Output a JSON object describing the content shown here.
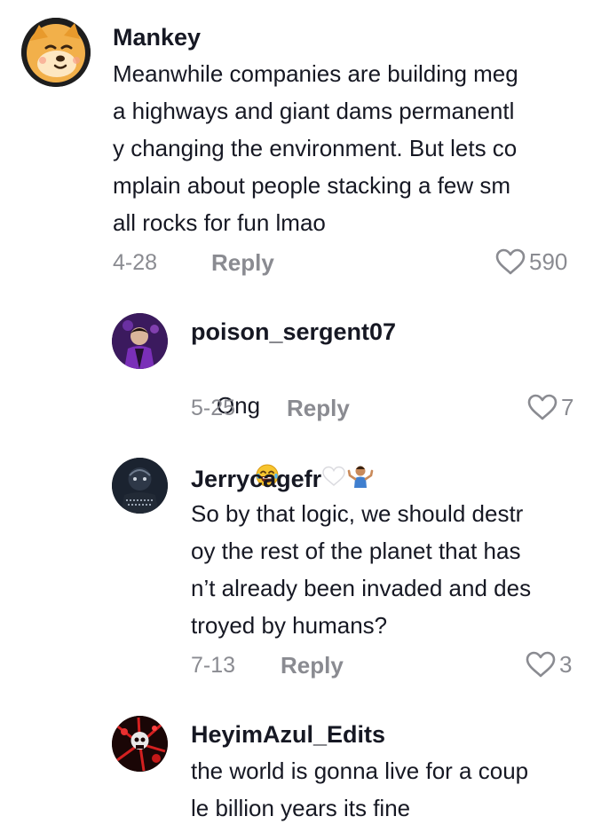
{
  "comments": [
    {
      "username": "Mankey",
      "lines": [
        "Meanwhile companies are building meg",
        "a highways and giant dams permanentl",
        "y changing the environment. But lets co",
        "mplain about people stacking a few sm",
        "all rocks for fun lmao"
      ],
      "date": "4-28",
      "reply_label": "Reply",
      "likes": "590",
      "avatar": "shiba-dog-avatar"
    },
    {
      "username": "poison_sergent07",
      "lines": [
        "Ong"
      ],
      "text_emoji": "crying-laughing-emoji",
      "date": "5-25",
      "reply_label": "Reply",
      "likes": "7",
      "avatar": "purple-figure-avatar"
    },
    {
      "username": "Jerrycagefr",
      "username_emoji": [
        "white-heart-emoji",
        "shrug-emoji"
      ],
      "lines": [
        "So by that logic, we should destr",
        "oy the rest of the planet that has",
        "n’t already been invaded and des",
        "troyed by humans?"
      ],
      "date": "7-13",
      "reply_label": "Reply",
      "likes": "3",
      "avatar": "dark-figure-avatar"
    },
    {
      "username": "HeyimAzul_Edits",
      "lines": [
        "the world is gonna live for a coup",
        "le billion years its fine"
      ],
      "avatar": "red-splatter-avatar"
    }
  ],
  "colors": {
    "text": "#161823",
    "muted": "#8a8b91"
  }
}
